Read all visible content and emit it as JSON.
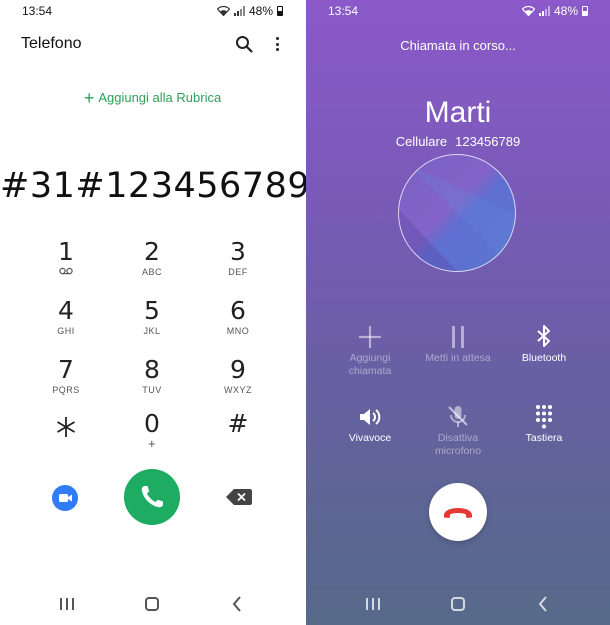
{
  "status_bar": {
    "time": "13:54",
    "battery": "48%"
  },
  "dialer": {
    "app_title": "Telefono",
    "add_contact_label": "Aggiungi alla Rubrica",
    "dialed_number": "#31#123456789",
    "keys": [
      {
        "digit": "1",
        "letters": ""
      },
      {
        "digit": "2",
        "letters": "ABC"
      },
      {
        "digit": "3",
        "letters": "DEF"
      },
      {
        "digit": "4",
        "letters": "GHI"
      },
      {
        "digit": "5",
        "letters": "JKL"
      },
      {
        "digit": "6",
        "letters": "MNO"
      },
      {
        "digit": "7",
        "letters": "PQRS"
      },
      {
        "digit": "8",
        "letters": "TUV"
      },
      {
        "digit": "9",
        "letters": "WXYZ"
      },
      {
        "digit": "*",
        "letters": ""
      },
      {
        "digit": "0",
        "letters": "+"
      },
      {
        "digit": "#",
        "letters": ""
      }
    ],
    "colors": {
      "accent": "#2ba15a",
      "call_button": "#1eac63",
      "video_button": "#2f7cf6"
    }
  },
  "in_call": {
    "status": "Chiamata in corso...",
    "caller_name": "Marti",
    "caller_type": "Cellulare",
    "caller_number": "123456789",
    "controls": [
      {
        "label_line1": "Aggiungi",
        "label_line2": "chiamata",
        "icon": "add-icon",
        "enabled": false
      },
      {
        "label_line1": "Metti in attesa",
        "label_line2": "",
        "icon": "pause-icon",
        "enabled": false
      },
      {
        "label_line1": "Bluetooth",
        "label_line2": "",
        "icon": "bluetooth-icon",
        "enabled": true
      },
      {
        "label_line1": "Vivavoce",
        "label_line2": "",
        "icon": "speaker-icon",
        "enabled": true
      },
      {
        "label_line1": "Disattiva",
        "label_line2": "microfono",
        "icon": "mic-off-icon",
        "enabled": false
      },
      {
        "label_line1": "Tastiera",
        "label_line2": "",
        "icon": "keypad-icon",
        "enabled": true
      }
    ],
    "colors": {
      "end_call": "#e53935",
      "background_top": "#8b59c9",
      "background_bottom": "#566a8a"
    }
  }
}
